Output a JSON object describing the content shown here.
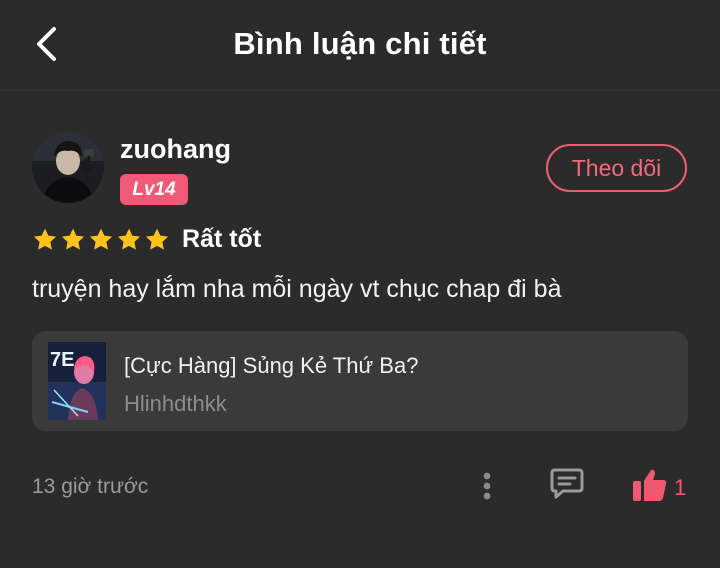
{
  "header": {
    "title": "Bình luận chi tiết",
    "back_icon": "chevron-left-icon"
  },
  "user": {
    "name": "zuohang",
    "level": "Lv14",
    "follow_label": "Theo dõi"
  },
  "rating": {
    "stars": 5,
    "max_stars": 5,
    "label": "Rất tốt",
    "star_color": "#ffc21a"
  },
  "comment": {
    "text": "truyện hay lắm nha mỗi ngày vt chục chap đi bà"
  },
  "story": {
    "title": "[Cực Hàng] Sủng Kẻ Thứ Ba?",
    "author": "Hlinhdthkk",
    "cover_text": "7E"
  },
  "footer": {
    "timestamp": "13 giờ trước",
    "like_count": "1"
  },
  "icons": {
    "more": "more-vertical-icon",
    "reply": "comment-icon",
    "like": "thumbs-up-icon"
  },
  "colors": {
    "accent": "#f05a76",
    "background": "#2b2b2b",
    "card": "#3a3a3a"
  }
}
